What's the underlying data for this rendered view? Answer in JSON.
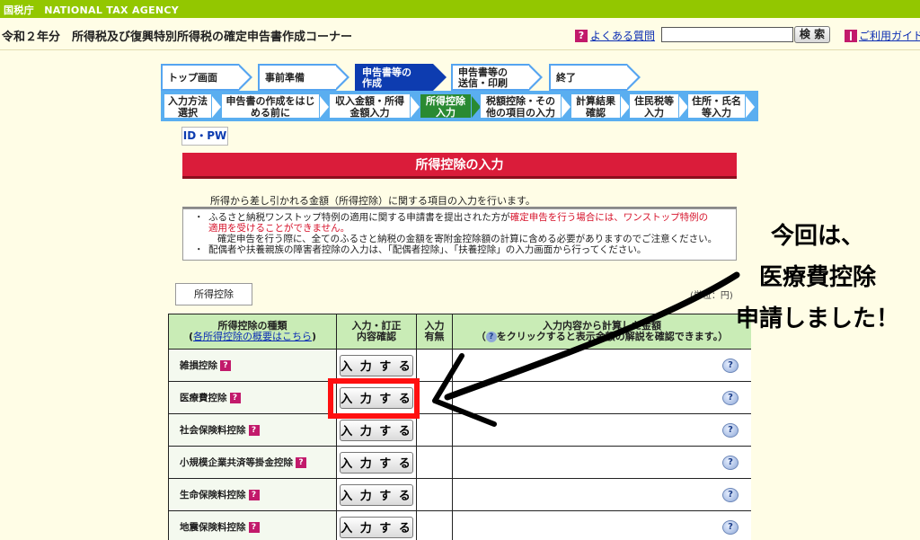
{
  "agency": "国税庁　NATIONAL TAX AGENCY",
  "header": {
    "title": "令和２年分　所得税及び復興特別所得税の確定申告書作成コーナー",
    "faq_link": "よくある質問",
    "search_placeholder": "",
    "search_button": "検 索",
    "guide_link": "ご利用ガイド"
  },
  "steps": [
    {
      "label": "トップ画面"
    },
    {
      "label": "事前準備"
    },
    {
      "line1": "申告書等の",
      "line2": "作成"
    },
    {
      "line1": "申告書等の",
      "line2": "送信・印刷"
    },
    {
      "label": "終了"
    }
  ],
  "substeps": [
    {
      "line1": "入力方法",
      "line2": "選択"
    },
    {
      "line1": "申告書の作成をはじ",
      "line2": "める前に"
    },
    {
      "line1": "収入金額・所得",
      "line2": "金額入力"
    },
    {
      "line1": "所得控除",
      "line2": "入力"
    },
    {
      "line1": "税額控除・その",
      "line2": "他の項目の入力"
    },
    {
      "line1": "計算結果",
      "line2": "確認"
    },
    {
      "line1": "住民税等",
      "line2": "入力"
    },
    {
      "line1": "住所・氏名",
      "line2": "等入力"
    }
  ],
  "idpw": "ID・PW",
  "section_title": "所得控除の入力",
  "intro": "所得から差し引かれる金額（所得控除）に関する項目の入力を行います。",
  "notices": {
    "n1_black": "ふるさと納税ワンストップ特例の適用に関する申請書を提出された方が",
    "n1_red1": "確定申告を行う場合には、ワンストップ特例の",
    "n1_red2": "適用を受けることができません。",
    "n1_cont": "確定申告を行う際に、全てのふるさと納税の金額を寄附金控除額の計算に含める必要がありますのでご注意ください。",
    "n2": "配偶者や扶養親族の障害者控除の入力は、「配偶者控除」、「扶養控除」の入力画面から行ってください。",
    "bullet": "・"
  },
  "section_label": "所得控除",
  "unit": "(単位：円)",
  "table": {
    "headers": {
      "type": "所得控除の種類",
      "type_link": "各所得控除の概要はこちら",
      "entry1": "入力・訂正",
      "entry2": "内容確認",
      "status1": "入力",
      "status2": "有無",
      "summary1": "入力内容から計算した金額",
      "summary2a": "（",
      "summary2b": "をクリックすると表示金額の解説を確認できます。）"
    },
    "button_label": "入 力 す る",
    "rows": [
      {
        "name": "雑損控除"
      },
      {
        "name": "医療費控除"
      },
      {
        "name": "社会保険料控除"
      },
      {
        "name": "小規模企業共済等掛金控除"
      },
      {
        "name": "生命保険料控除"
      },
      {
        "name": "地震保険料控除"
      }
    ]
  },
  "annotation": {
    "line1": "今回は、",
    "line2": "医療費控除",
    "line3": "申請しました！"
  },
  "colors": {
    "topbar": "#93c700",
    "active_step": "#0d3cb0",
    "active_substep": "#2a8a32",
    "banner": "#da1c3a",
    "highlight": "#ff1010"
  }
}
